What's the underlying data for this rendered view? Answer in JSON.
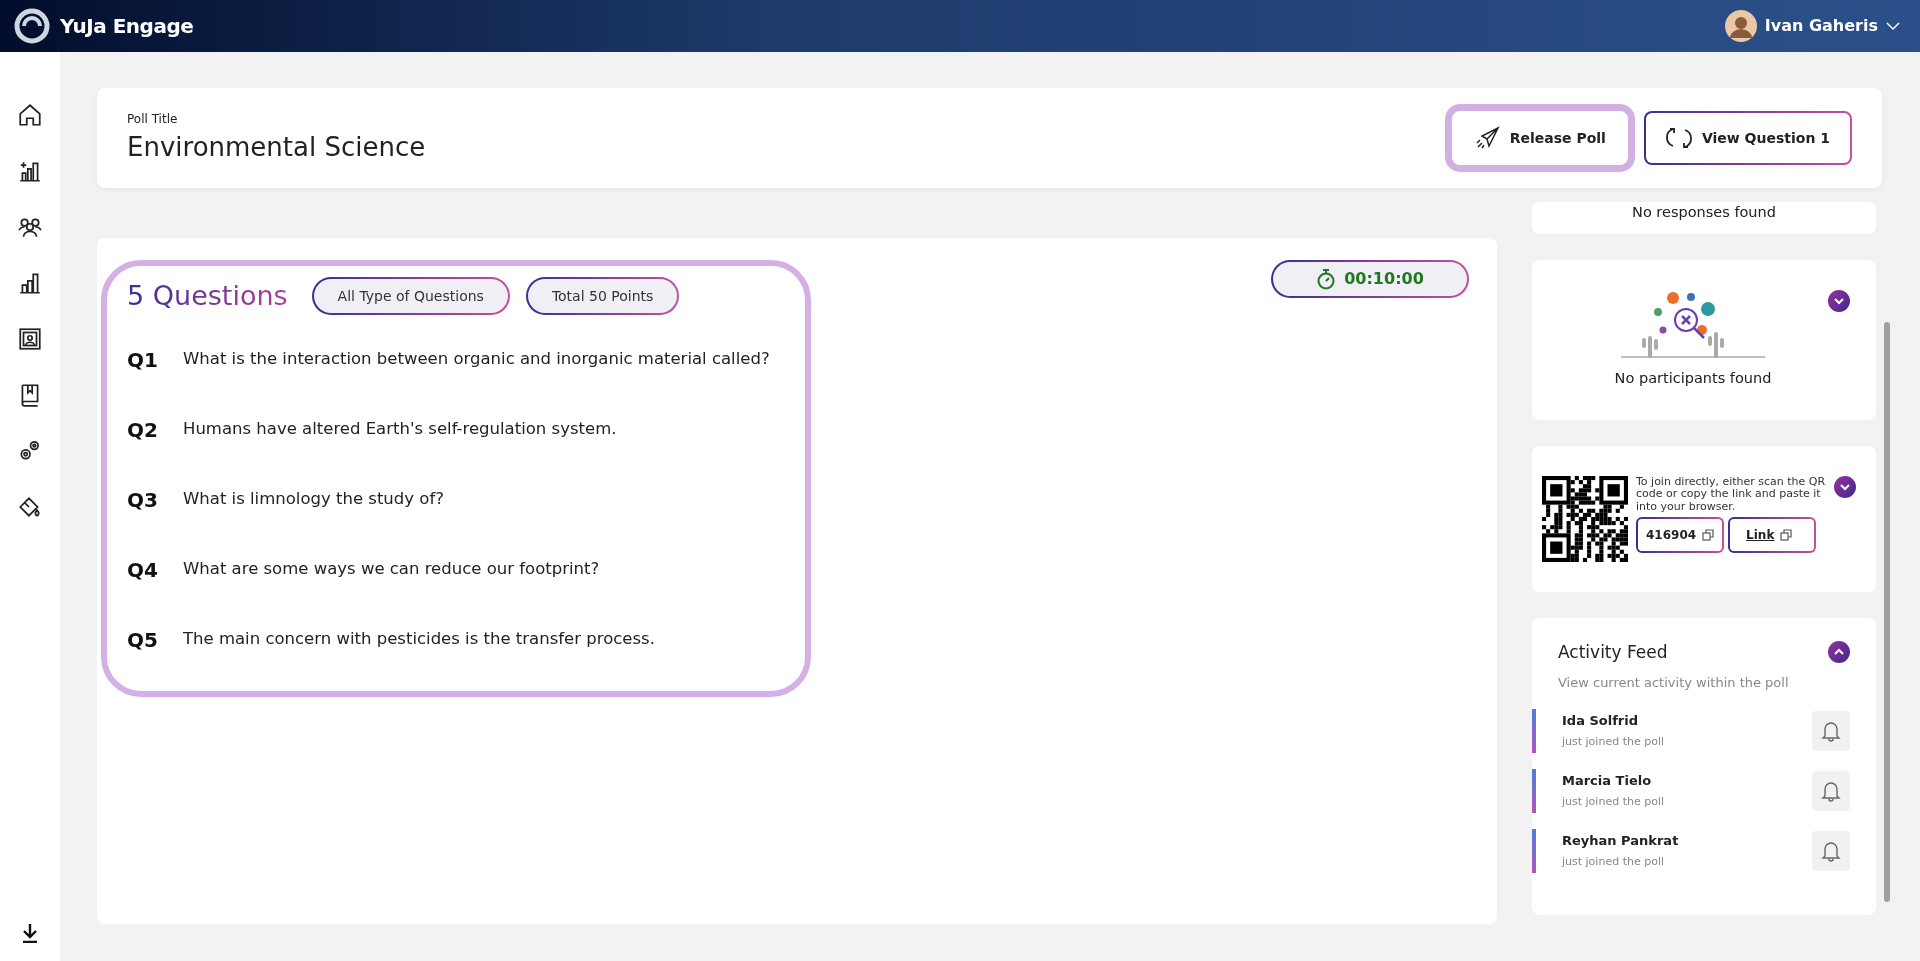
{
  "app": {
    "name": "YuJa Engage"
  },
  "user": {
    "name": "Ivan Gaheris"
  },
  "poll": {
    "title_label": "Poll Title",
    "title": "Environmental Science"
  },
  "header_buttons": [
    {
      "kind": "release",
      "label": "Release Poll",
      "highlighted": true
    },
    {
      "kind": "view",
      "label": "View Question 1",
      "highlighted": false
    }
  ],
  "questions_panel": {
    "heading": "5 Questions",
    "highlighted": true,
    "filters": [
      "All Type of Questions",
      "Total 50 Points"
    ],
    "timer": "00:10:00",
    "questions": [
      {
        "number": "Q1",
        "text": "What is the interaction between organic and inorganic material called?"
      },
      {
        "number": "Q2",
        "text": "Humans have altered Earth's self-regulation system."
      },
      {
        "number": "Q3",
        "text": "What is limnology the study of?"
      },
      {
        "number": "Q4",
        "text": "What are some ways we can reduce our footprint?"
      },
      {
        "number": "Q5",
        "text": "The main concern with pesticides is the transfer process."
      }
    ]
  },
  "responses_panel": {
    "message": "No responses found"
  },
  "participants_panel": {
    "message": "No participants found",
    "expanded": false
  },
  "join_panel": {
    "instructions": "To join directly, either scan the QR code or copy the link and paste it into your browser.",
    "code": "416904",
    "link": "Link",
    "expanded": false
  },
  "activity_feed": {
    "title": "Activity Feed",
    "subtitle": "View current activity within the poll",
    "expanded": true,
    "items": [
      {
        "name": "Ida Solfrid",
        "action": "just joined the poll"
      },
      {
        "name": "Marcia Tielo",
        "action": "just joined the poll"
      },
      {
        "name": "Reyhan Pankrat",
        "action": "just joined the poll"
      }
    ]
  }
}
